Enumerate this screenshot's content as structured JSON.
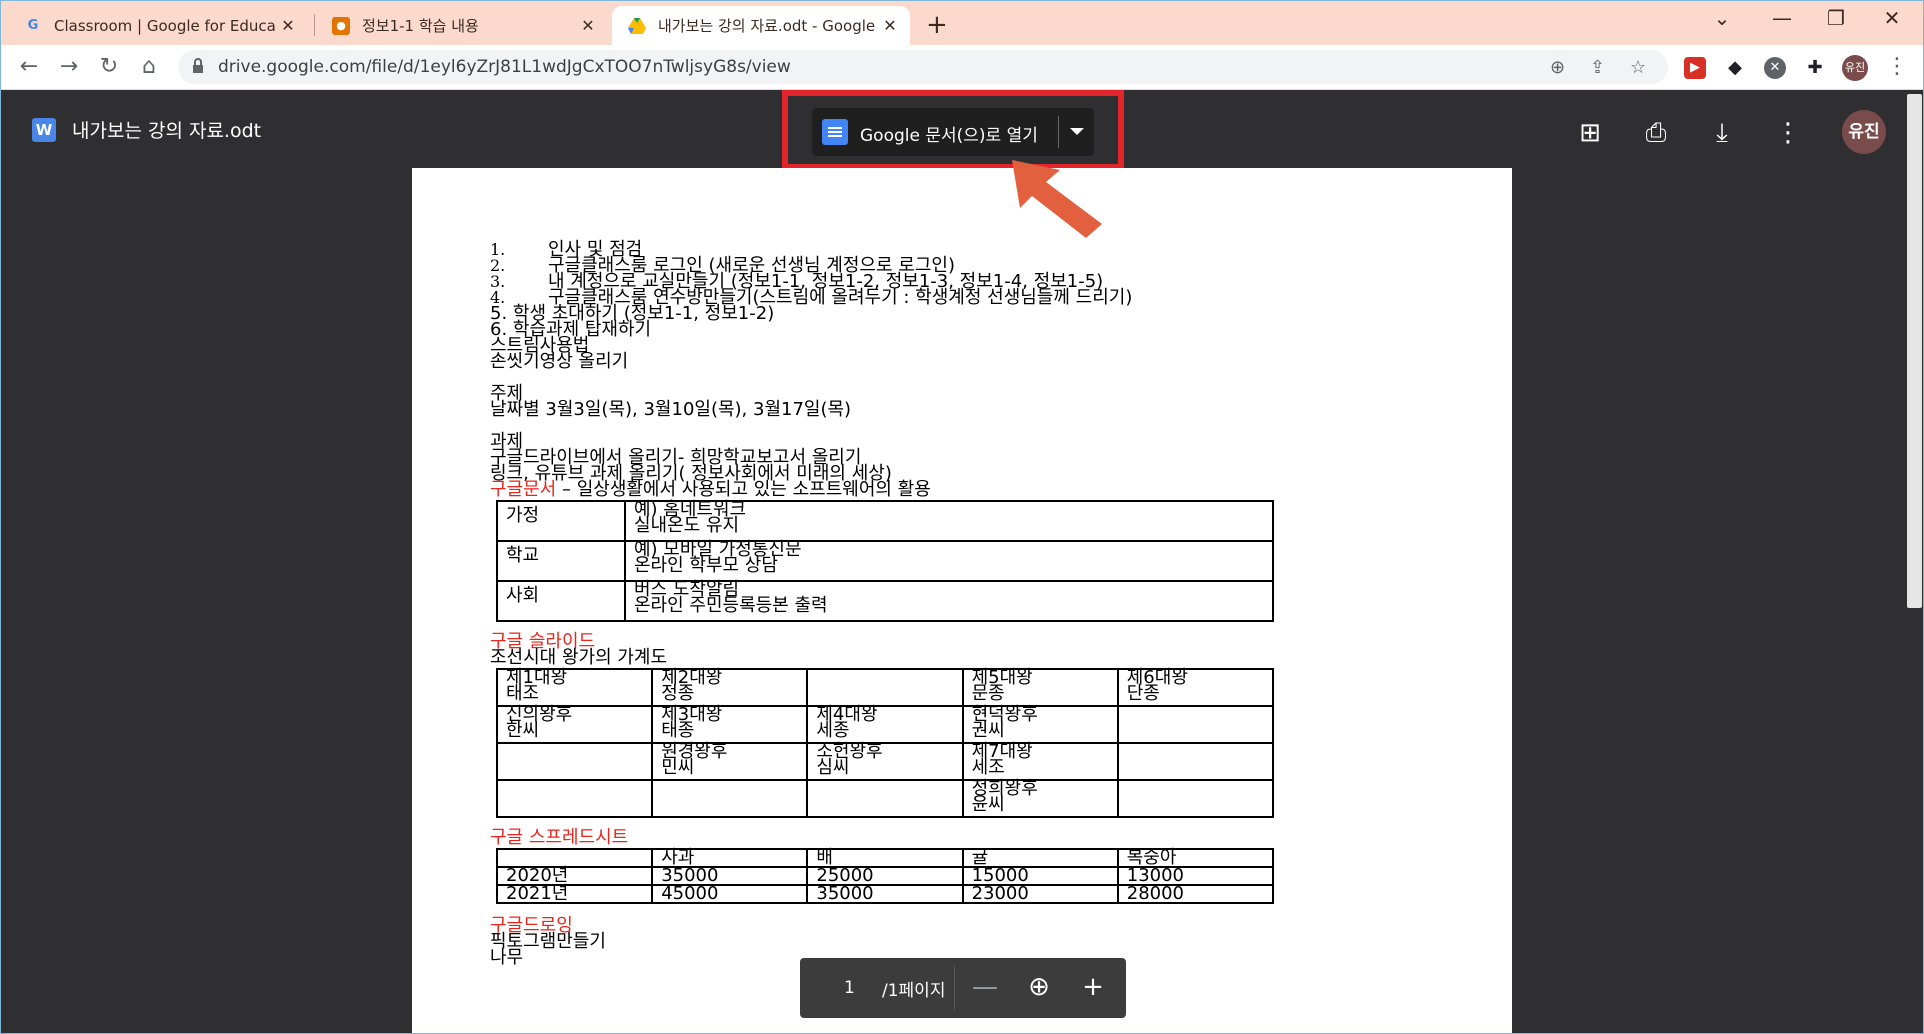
{
  "tabs": [
    {
      "title": "Classroom | Google for Educatio",
      "favicon": "google-g-icon",
      "active": false
    },
    {
      "title": "정보1-1 학습 내용",
      "favicon": "classroom-icon",
      "active": false
    },
    {
      "title": "내가보는 강의 자료.odt - Google Drive",
      "favicon": "drive-icon",
      "active": true
    }
  ],
  "tab_close_glyph": "✕",
  "new_tab_glyph": "+",
  "window_controls": {
    "chevron": "⌄",
    "minimize": "—",
    "restore": "❐",
    "close": "✕"
  },
  "address": {
    "url": "drive.google.com/file/d/1eyl6yZrJ81L1wdJgCxTOO7nTwljsyG8s/view"
  },
  "profile_small": "유진",
  "viewer": {
    "filename": "내가보는 강의 자료.odt",
    "file_badge": "W",
    "open_with_label": "Google 문서(으)로 열기",
    "avatar": "유진"
  },
  "document": {
    "numbered": [
      {
        "n": "1.",
        "t": "인사 및 점검"
      },
      {
        "n": "2.",
        "t": "구글클래스룸 로그인 (새로운 선생님 계정으로 로그인)"
      },
      {
        "n": "3.",
        "t": "내 계정으로 교실만들기 (정보1-1, 정보1-2, 정보1-3, 정보1-4, 정보1-5)"
      },
      {
        "n": "4.",
        "t": "구글클래스룸 연수방만들기(스트림에 올려두기 : 학생계정 선생님들께 드리기)"
      }
    ],
    "lines_a": [
      "5. 학생 초대하기 (정보1-1, 정보1-2)",
      "6. 학습과제 탑재하기",
      "스트림사용법",
      "손씻기영상 올리기"
    ],
    "lines_b": [
      "주제",
      "날짜별 3월3일(목), 3월10일(목), 3월17일(목)"
    ],
    "lines_c": [
      "과제",
      "구글드라이브에서 올리기- 희망학교보고서 올리기",
      "링크, 유튜브 과제 올리기( 정보사회에서 미래의 세상)"
    ],
    "docs_heading_red": "구글문서",
    "docs_heading_rest": " – 일상생활에서 사용되고 있는 소프트웨어의 활용",
    "table1": [
      [
        "가정",
        "예) 홈네트워크",
        "실내온도 유지"
      ],
      [
        "학교",
        "예) 모바일 가정통신문",
        "온라인 학부모 상담"
      ],
      [
        "사회",
        "버스 도착알림",
        "온라인 주민등록등본 출력"
      ]
    ],
    "slides_heading": "구글 슬라이드",
    "slides_sub": "조선시대 왕가의 가계도",
    "table2": [
      [
        [
          "제1대왕",
          "태조"
        ],
        [
          "제2대왕",
          "정종"
        ],
        [
          "",
          ""
        ],
        [
          "제5대왕",
          "문종"
        ],
        [
          "제6대왕",
          "단종"
        ]
      ],
      [
        [
          "신의왕후",
          "한씨"
        ],
        [
          "제3대왕",
          "태종"
        ],
        [
          "제4대왕",
          "세종"
        ],
        [
          "현덕왕후",
          "권씨"
        ],
        [
          "",
          ""
        ]
      ],
      [
        [
          "",
          ""
        ],
        [
          "원경왕후",
          "민씨"
        ],
        [
          "소헌왕후",
          "심씨"
        ],
        [
          "제7대왕",
          "세조"
        ],
        [
          "",
          ""
        ]
      ],
      [
        [
          "",
          ""
        ],
        [
          "",
          ""
        ],
        [
          "",
          ""
        ],
        [
          "정희왕후",
          "윤씨"
        ],
        [
          "",
          ""
        ]
      ]
    ],
    "sheets_heading": "구글 스프레드시트",
    "table3": [
      [
        "",
        "사과",
        "배",
        "귤",
        "복숭아"
      ],
      [
        "2020년",
        "35000",
        "25000",
        "15000",
        "13000"
      ],
      [
        "2021년",
        "45000",
        "35000",
        "23000",
        "28000"
      ]
    ],
    "drawing_heading": "구글드로잉",
    "drawing_lines": [
      "픽토그램만들기",
      "나무"
    ]
  },
  "pager": {
    "current": "1",
    "total": "/1페이지"
  }
}
